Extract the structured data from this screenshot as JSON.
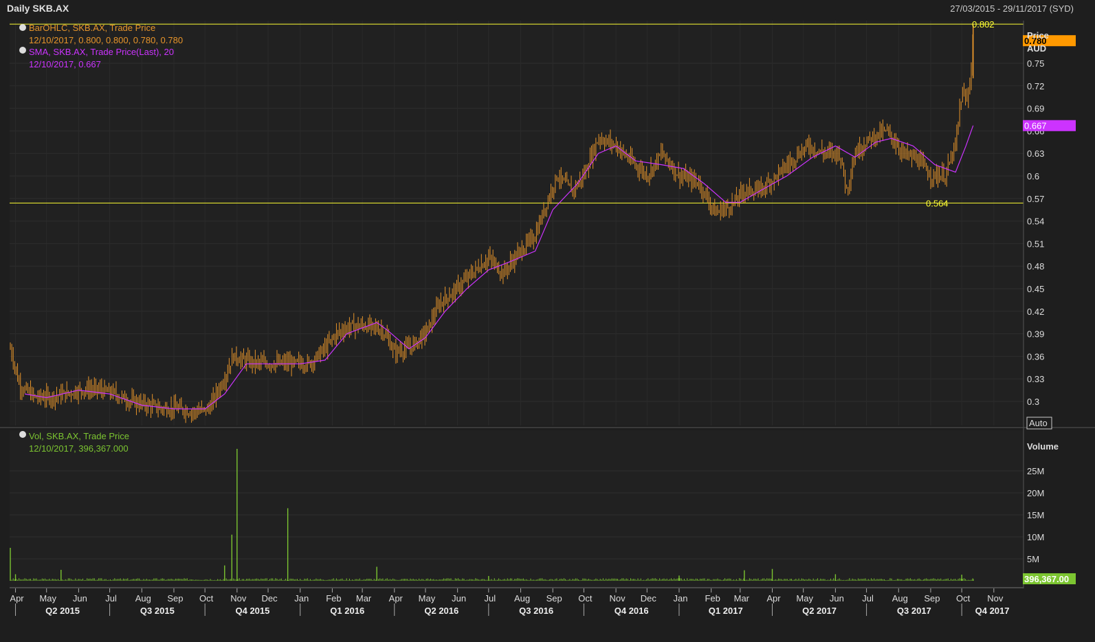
{
  "header": {
    "title": "Daily SKB.AX",
    "range": "27/03/2015 - 29/11/2017 (SYD)"
  },
  "legend": {
    "ohlc_label": "BarOHLC, SKB.AX, Trade Price",
    "ohlc_values": "12/10/2017, 0.800, 0.800, 0.780, 0.780",
    "sma_label": "SMA, SKB.AX, Trade Price(Last),  20",
    "sma_values": "12/10/2017, 0.667",
    "vol_label": "Vol, SKB.AX, Trade Price",
    "vol_values": "12/10/2017, 396,367.000"
  },
  "axis": {
    "price_title": "Price",
    "price_unit": "AUD",
    "auto_label": "Auto",
    "volume_title": "Volume",
    "last_price_tag": "0.780",
    "sma_tag": "0.667",
    "volume_tag": "396,367.00",
    "high_line_label": "0.802",
    "low_line_label": "0.564"
  },
  "colors": {
    "background": "#1e1e1e",
    "plot_bg": "#222222",
    "bars": "#e8952a",
    "sma": "#cc33ff",
    "volume": "#7cc531",
    "hline": "#ffff33",
    "text": "#cccccc",
    "last_tag_bg": "#ff9900"
  },
  "chart_data": [
    {
      "type": "bar",
      "subtype": "ohlc",
      "title": "Daily SKB.AX",
      "ylabel": "Price AUD",
      "ylim": [
        0.27,
        0.81
      ],
      "yticks": [
        0.3,
        0.33,
        0.36,
        0.39,
        0.42,
        0.45,
        0.48,
        0.51,
        0.54,
        0.57,
        0.6,
        0.63,
        0.66,
        0.69,
        0.72,
        0.75,
        "AUD"
      ],
      "x_months": [
        "Apr",
        "May",
        "Jun",
        "Jul",
        "Aug",
        "Sep",
        "Oct",
        "Nov",
        "Dec",
        "Jan",
        "Feb",
        "Mar",
        "Apr",
        "May",
        "Jun",
        "Jul",
        "Aug",
        "Sep",
        "Oct",
        "Nov",
        "Dec",
        "Jan",
        "Feb",
        "Mar",
        "Apr",
        "May",
        "Jun",
        "Jul",
        "Aug",
        "Sep",
        "Oct",
        "Nov"
      ],
      "x_quarters": [
        "Q2 2015",
        "Q3 2015",
        "Q4 2015",
        "Q1 2016",
        "Q2 2016",
        "Q3 2016",
        "Q4 2016",
        "Q1 2017",
        "Q2 2017",
        "Q3 2017",
        "Q4 2017"
      ],
      "horizontal_lines": [
        0.802,
        0.564
      ],
      "close_series": [
        [
          "2015-03-27",
          0.37
        ],
        [
          "2015-04-05",
          0.32
        ],
        [
          "2015-04-20",
          0.305
        ],
        [
          "2015-05-05",
          0.305
        ],
        [
          "2015-05-20",
          0.31
        ],
        [
          "2015-06-05",
          0.315
        ],
        [
          "2015-06-20",
          0.315
        ],
        [
          "2015-07-05",
          0.31
        ],
        [
          "2015-07-20",
          0.3
        ],
        [
          "2015-08-05",
          0.295
        ],
        [
          "2015-08-20",
          0.29
        ],
        [
          "2015-09-05",
          0.29
        ],
        [
          "2015-09-20",
          0.285
        ],
        [
          "2015-10-05",
          0.29
        ],
        [
          "2015-10-12",
          0.31
        ],
        [
          "2015-10-20",
          0.33
        ],
        [
          "2015-10-28",
          0.36
        ],
        [
          "2015-11-05",
          0.355
        ],
        [
          "2015-11-20",
          0.35
        ],
        [
          "2015-12-05",
          0.35
        ],
        [
          "2015-12-20",
          0.35
        ],
        [
          "2016-01-10",
          0.35
        ],
        [
          "2016-01-25",
          0.37
        ],
        [
          "2016-02-05",
          0.39
        ],
        [
          "2016-02-20",
          0.4
        ],
        [
          "2016-03-05",
          0.4
        ],
        [
          "2016-03-20",
          0.395
        ],
        [
          "2016-04-01",
          0.365
        ],
        [
          "2016-04-15",
          0.37
        ],
        [
          "2016-05-01",
          0.39
        ],
        [
          "2016-05-15",
          0.43
        ],
        [
          "2016-06-01",
          0.45
        ],
        [
          "2016-06-15",
          0.47
        ],
        [
          "2016-07-01",
          0.49
        ],
        [
          "2016-07-15",
          0.47
        ],
        [
          "2016-08-01",
          0.5
        ],
        [
          "2016-08-15",
          0.52
        ],
        [
          "2016-08-25",
          0.56
        ],
        [
          "2016-09-05",
          0.6
        ],
        [
          "2016-09-20",
          0.58
        ],
        [
          "2016-10-01",
          0.6
        ],
        [
          "2016-10-15",
          0.65
        ],
        [
          "2016-11-01",
          0.64
        ],
        [
          "2016-11-15",
          0.62
        ],
        [
          "2016-12-01",
          0.6
        ],
        [
          "2016-12-15",
          0.63
        ],
        [
          "2017-01-01",
          0.6
        ],
        [
          "2017-01-20",
          0.59
        ],
        [
          "2017-02-05",
          0.55
        ],
        [
          "2017-02-20",
          0.56
        ],
        [
          "2017-03-05",
          0.58
        ],
        [
          "2017-03-20",
          0.58
        ],
        [
          "2017-04-05",
          0.6
        ],
        [
          "2017-04-20",
          0.62
        ],
        [
          "2017-05-05",
          0.64
        ],
        [
          "2017-05-20",
          0.63
        ],
        [
          "2017-06-05",
          0.63
        ],
        [
          "2017-06-12",
          0.58
        ],
        [
          "2017-06-20",
          0.63
        ],
        [
          "2017-07-05",
          0.65
        ],
        [
          "2017-07-20",
          0.66
        ],
        [
          "2017-08-05",
          0.63
        ],
        [
          "2017-08-20",
          0.62
        ],
        [
          "2017-09-01",
          0.6
        ],
        [
          "2017-09-15",
          0.6
        ],
        [
          "2017-09-25",
          0.64
        ],
        [
          "2017-10-01",
          0.71
        ],
        [
          "2017-10-06",
          0.7
        ],
        [
          "2017-10-10",
          0.74
        ],
        [
          "2017-10-12",
          0.78
        ]
      ]
    },
    {
      "type": "line",
      "name": "SMA, SKB.AX, Trade Price(Last),  20",
      "ylim": [
        0.27,
        0.81
      ],
      "x": [
        "2015-04-10",
        "2015-05-01",
        "2015-06-01",
        "2015-07-01",
        "2015-08-01",
        "2015-09-01",
        "2015-10-01",
        "2015-10-20",
        "2015-11-10",
        "2015-12-01",
        "2016-01-01",
        "2016-01-25",
        "2016-02-15",
        "2016-03-15",
        "2016-03-25",
        "2016-04-15",
        "2016-05-01",
        "2016-05-20",
        "2016-06-10",
        "2016-07-01",
        "2016-07-20",
        "2016-08-15",
        "2016-09-01",
        "2016-09-25",
        "2016-10-15",
        "2016-11-01",
        "2016-11-20",
        "2016-12-15",
        "2017-01-05",
        "2017-01-25",
        "2017-02-15",
        "2017-03-01",
        "2017-03-20",
        "2017-04-15",
        "2017-05-10",
        "2017-06-01",
        "2017-06-20",
        "2017-07-10",
        "2017-07-25",
        "2017-08-15",
        "2017-09-05",
        "2017-09-25",
        "2017-10-05",
        "2017-10-12"
      ],
      "values": [
        0.31,
        0.305,
        0.315,
        0.31,
        0.295,
        0.29,
        0.29,
        0.31,
        0.35,
        0.35,
        0.35,
        0.355,
        0.39,
        0.405,
        0.395,
        0.37,
        0.385,
        0.42,
        0.45,
        0.475,
        0.485,
        0.5,
        0.555,
        0.59,
        0.63,
        0.64,
        0.62,
        0.615,
        0.61,
        0.59,
        0.565,
        0.565,
        0.58,
        0.6,
        0.625,
        0.64,
        0.625,
        0.645,
        0.65,
        0.64,
        0.615,
        0.605,
        0.64,
        0.667
      ]
    },
    {
      "type": "bar",
      "name": "Vol, SKB.AX, Trade Price",
      "ylabel": "Volume",
      "yticks": [
        "5M",
        "10M",
        "15M",
        "20M",
        "25M"
      ],
      "ylim": [
        0,
        33000000
      ],
      "x": [
        "2015-03-27",
        "2015-04-01",
        "2015-05-15",
        "2015-10-20",
        "2015-10-27",
        "2015-11-01",
        "2015-12-20",
        "2016-03-15",
        "2016-07-01",
        "2017-01-01",
        "2017-03-05",
        "2017-04-01",
        "2017-06-01",
        "2017-10-01",
        "2017-10-12"
      ],
      "values": [
        7500000,
        1500000,
        2500000,
        3500000,
        10500000,
        30000000,
        16500000,
        3200000,
        1100000,
        1200000,
        2400000,
        2700000,
        1500000,
        1400000,
        396367
      ]
    }
  ]
}
